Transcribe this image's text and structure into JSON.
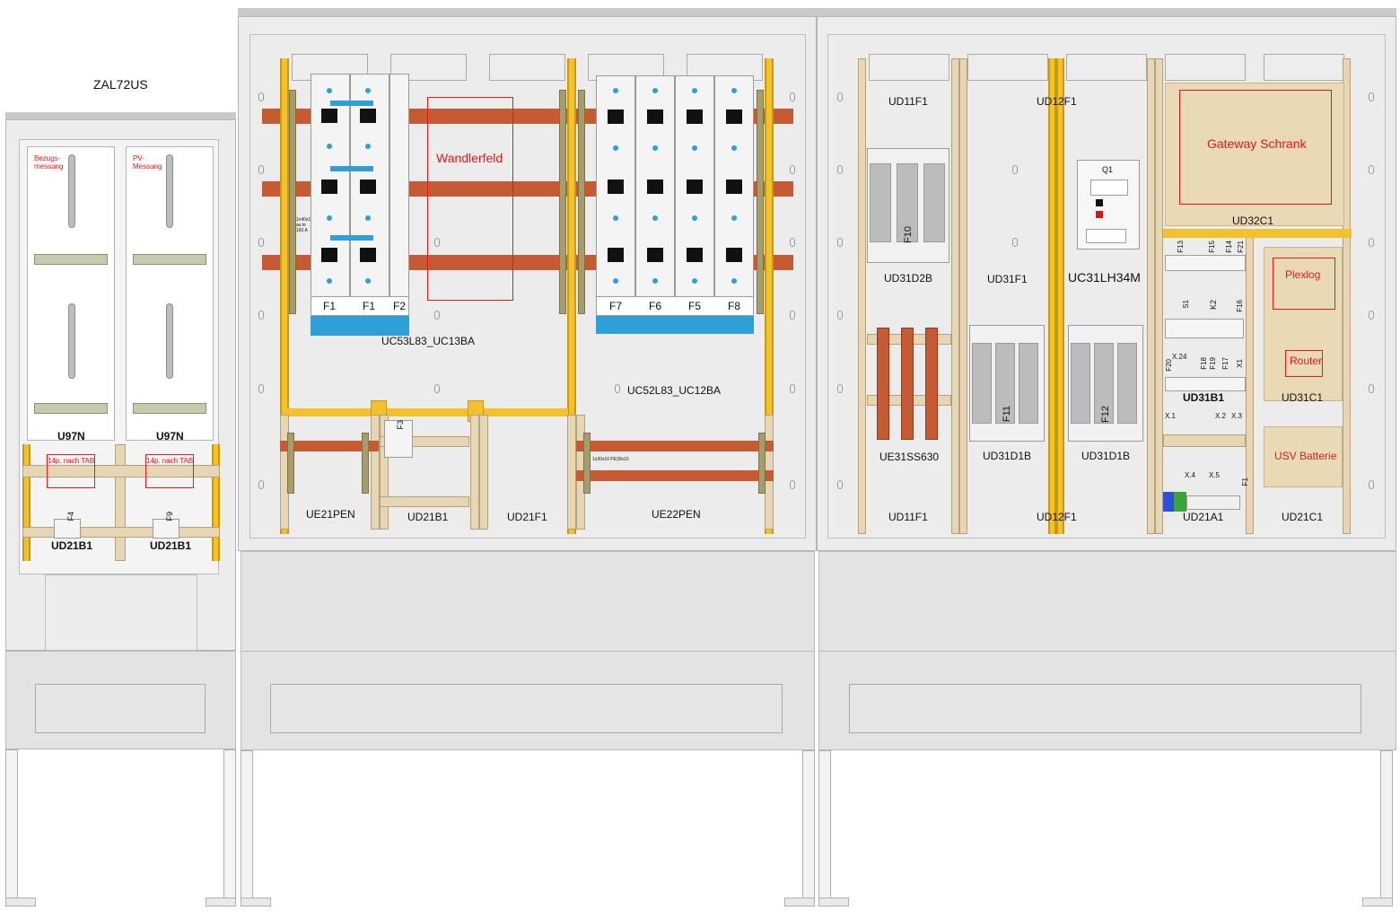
{
  "title": "ZAL72US",
  "left_cabinet": {
    "meter_labels": [
      "Bezugs-\nmessung",
      "PV-\nMessung"
    ],
    "u97n": [
      "U97N",
      "U97N"
    ],
    "tab_notes": [
      "14p. nach TAB",
      "14p. nach TAB"
    ],
    "fuses": [
      "F4",
      "F9"
    ],
    "bottom": [
      "UD21B1",
      "UD21B1"
    ]
  },
  "middle_cabinet": {
    "fuse_left": [
      "F1",
      "F1",
      "F2"
    ],
    "fuse_right": [
      "F7",
      "F6",
      "F5",
      "F8"
    ],
    "wandlerfeld": "Wandlerfeld",
    "uc_left": "UC53L83_UC13BA",
    "uc_right": "UC52L83_UC12BA",
    "f3": "F3",
    "small_left": "1x40x10\nau le\n160 A",
    "small_right": "1x30x10 PE30x10",
    "bottom": [
      "UE21PEN",
      "UD21B1",
      "UD21F1",
      "UE22PEN"
    ]
  },
  "right_cabinet": {
    "top": [
      "UD11F1",
      "UD12F1"
    ],
    "q1": "Q1",
    "uc31": "UC31LH34M",
    "gateway": "Gateway Schrank",
    "ud32c1": "UD32C1",
    "ud31d2b": "UD31D2B",
    "ud31f1": "UD31F1",
    "f10": "F10",
    "f11": "F11",
    "f12": "F12",
    "plexlog": "Plexlog",
    "router": "Router",
    "ud31c1": "UD31C1",
    "usv": "USV Batterie",
    "ue31": "UE31SS630",
    "ud31d1b": [
      "UD31D1B",
      "UD31D1B"
    ],
    "ud31b1": "UD31B1",
    "terminals": [
      "F13",
      "F15",
      "F14",
      "F21",
      "S1",
      "K2",
      "F16",
      "X.24",
      "F20",
      "F18",
      "F19",
      "F17",
      "X1",
      "X.1",
      "X.2",
      "X.3",
      "X.4",
      "X.5",
      "F1"
    ],
    "bottom": [
      "UD11F1",
      "UD12F1",
      "UD21A1",
      "UD21C1"
    ]
  }
}
